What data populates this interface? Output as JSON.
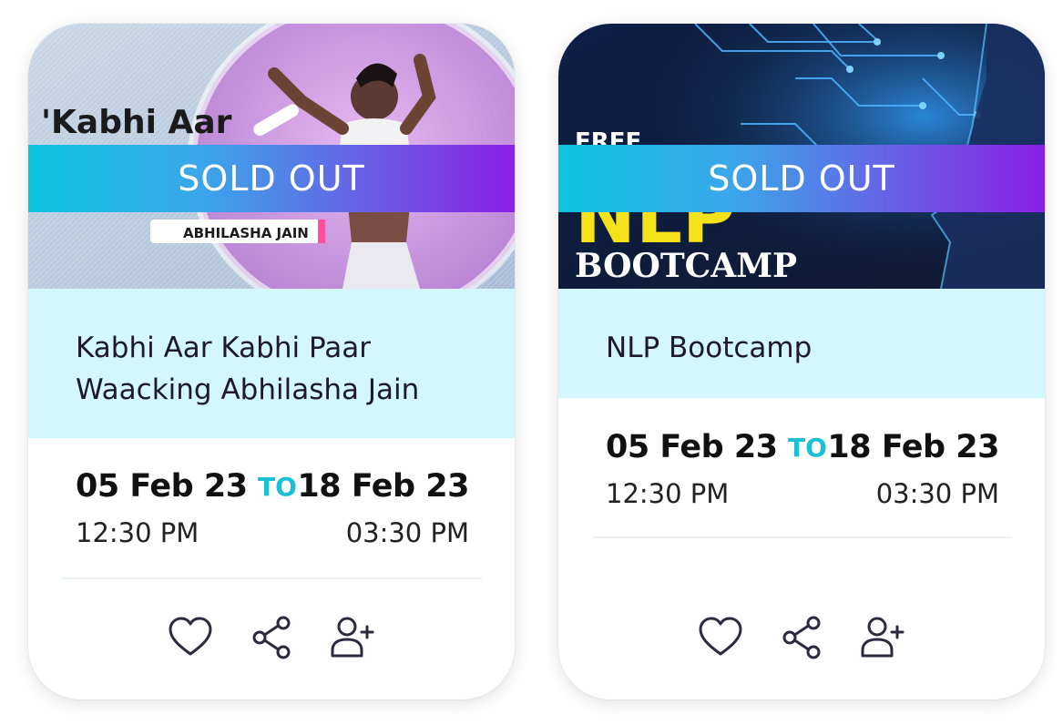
{
  "cards": [
    {
      "banner_text": "'Kabhi Aar",
      "banner_subtext": "ABHILASHA JAIN",
      "sold_out_label": "SOLD OUT",
      "title": "Kabhi Aar Kabhi Paar Waacking Abhilasha Jain",
      "start_date": "05 Feb 23",
      "to_label": "TO",
      "end_date": "18 Feb 23",
      "start_time": "12:30 PM",
      "end_time": "03:30 PM",
      "icons": [
        "heart-icon",
        "share-icon",
        "add-user-icon"
      ]
    },
    {
      "banner_text": "FREE",
      "banner_big": "NLP",
      "banner_subtext": "BOOTCAMP",
      "sold_out_label": "SOLD OUT",
      "title": "NLP Bootcamp",
      "start_date": "05 Feb 23",
      "to_label": "TO",
      "end_date": "18 Feb 23",
      "start_time": "12:30 PM",
      "end_time": "03:30 PM",
      "icons": [
        "heart-icon",
        "share-icon",
        "add-user-icon"
      ]
    }
  ],
  "colors": {
    "accent": "#19c0d8",
    "title_bg": "#d3f7fc",
    "gradient_start": "#0cc5df",
    "gradient_end": "#8a1fe6",
    "icon_stroke": "#2d2a3e"
  }
}
